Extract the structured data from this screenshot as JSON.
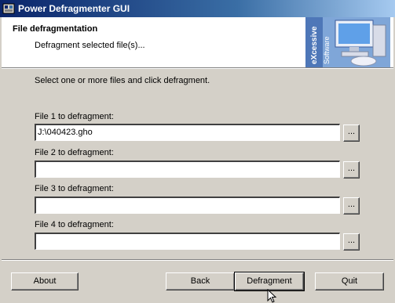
{
  "window": {
    "title": "Power Defragmenter GUI"
  },
  "header": {
    "title": "File defragmentation",
    "subtitle": "Defragment selected file(s)...",
    "logo_text": "eXcessive Software"
  },
  "main": {
    "instruction": "Select one or more files and click defragment.",
    "files": [
      {
        "label": "File 1 to defragment:",
        "value": "J:\\040423.gho"
      },
      {
        "label": "File 2 to defragment:",
        "value": ""
      },
      {
        "label": "File 3 to defragment:",
        "value": ""
      },
      {
        "label": "File 4 to defragment:",
        "value": ""
      }
    ],
    "browse_label": "..."
  },
  "buttons": {
    "about": "About",
    "back": "Back",
    "defragment": "Defragment",
    "quit": "Quit"
  }
}
